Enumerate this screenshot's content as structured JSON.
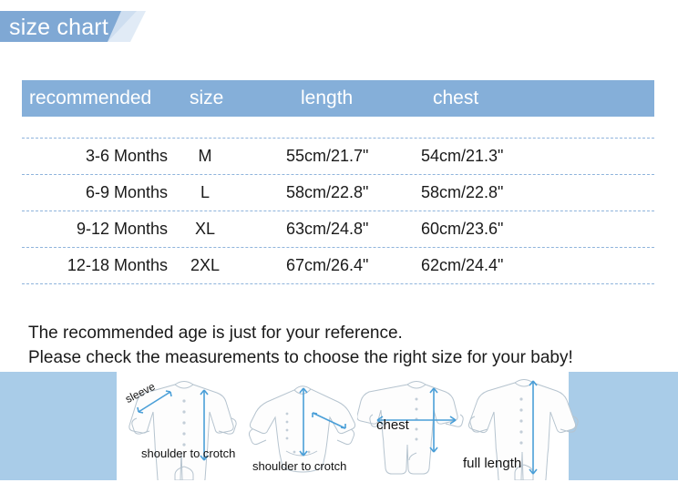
{
  "banner": {
    "title": "size chart",
    "background_color": "#7fa8d4",
    "text_color": "#ffffff"
  },
  "table": {
    "header_background_color": "#85afd9",
    "divider_color": "#8fb4dc",
    "columns": [
      {
        "key": "recommended",
        "label": "recommended"
      },
      {
        "key": "size",
        "label": "size"
      },
      {
        "key": "length",
        "label": "length"
      },
      {
        "key": "chest",
        "label": "chest"
      }
    ],
    "rows": [
      {
        "recommended": "3-6 Months",
        "size": "M",
        "length": "55cm/21.7\"",
        "chest": "54cm/21.3\""
      },
      {
        "recommended": "6-9 Months",
        "size": "L",
        "length": "58cm/22.8\"",
        "chest": "58cm/22.8\""
      },
      {
        "recommended": "9-12 Months",
        "size": "XL",
        "length": "63cm/24.8\"",
        "chest": "60cm/23.6\""
      },
      {
        "recommended": "12-18 Months",
        "size": "2XL",
        "length": "67cm/26.4\"",
        "chest": "62cm/24.4\""
      }
    ]
  },
  "note": {
    "line1": "The recommended age is just for your reference.",
    "line2": "Please check the measurements to choose the right size for your baby!"
  },
  "illustrations": {
    "band_color": "#a9cce8",
    "box_color": "#ffffff",
    "arrow_color": "#4a9fd8",
    "figures": [
      {
        "garment": "long-sleeve-footed-romper",
        "labels": {
          "sleeve": "sleeve",
          "length": "shoulder to crotch"
        }
      },
      {
        "garment": "long-sleeve-bodysuit",
        "labels": {
          "length": "shoulder to crotch"
        }
      },
      {
        "garment": "short-sleeve-romper",
        "labels": {
          "chest": "chest"
        }
      },
      {
        "garment": "long-sleeve-footed-romper-full",
        "labels": {
          "length": "full length"
        }
      }
    ]
  }
}
